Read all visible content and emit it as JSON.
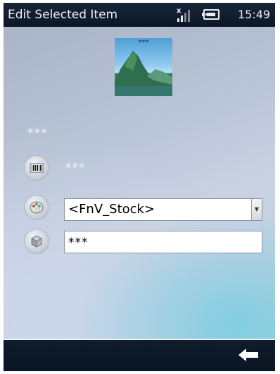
{
  "window": {
    "title": "Edit Selected Item",
    "clock": "15:49"
  },
  "status_icons": {
    "signal": "signal-no-service-icon",
    "battery": "battery-charging-icon"
  },
  "item": {
    "image_label": "***",
    "name": "***",
    "barcode": "***",
    "category_select": {
      "selected": "<FnV_Stock>"
    },
    "quantity_field": {
      "value": "***"
    }
  },
  "row_icons": [
    "barcode-icon",
    "palette-icon",
    "box-icon"
  ],
  "menu": {
    "back_icon": "back-arrow-icon"
  },
  "colors": {
    "titlebar": "#0c1725",
    "content_bg": "#b8c3d6",
    "accent_cyan": "#78cde1"
  }
}
